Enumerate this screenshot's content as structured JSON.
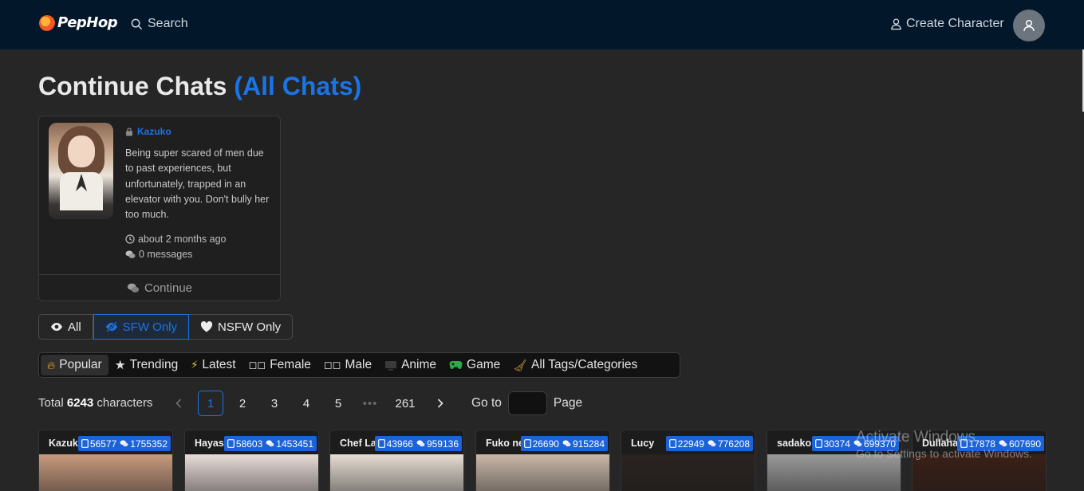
{
  "header": {
    "logo_text": "PepHop",
    "search_label": "Search",
    "create_label": "Create Character"
  },
  "title": {
    "main": "Continue Chats",
    "link": "(All Chats)"
  },
  "chat_card": {
    "name": "Kazuko",
    "description": "Being super scared of men due to past experiences, but unfortunately, trapped in an elevator with you. Don't bully her too much.",
    "last_active": "about 2 months ago",
    "messages": "0 messages",
    "continue_label": "Continue"
  },
  "filters": {
    "all": "All",
    "sfw": "SFW Only",
    "nsfw": "NSFW Only",
    "selected": "SFW Only"
  },
  "tags": [
    {
      "label": "Popular",
      "icon": "fire-icon",
      "active": true
    },
    {
      "label": "Trending",
      "icon": "star-icon"
    },
    {
      "label": "Latest",
      "icon": "bolt-icon"
    },
    {
      "label": "Female",
      "icon": "female-icon"
    },
    {
      "label": "Male",
      "icon": "male-icon"
    },
    {
      "label": "Anime",
      "icon": "tv-icon"
    },
    {
      "label": "Game",
      "icon": "gamepad-icon"
    },
    {
      "label": "All Tags/Categories",
      "icon": "broom-icon"
    }
  ],
  "pagination": {
    "total_prefix": "Total",
    "total_count": "6243",
    "total_suffix": "characters",
    "pages": [
      "1",
      "2",
      "3",
      "4",
      "5"
    ],
    "ellipsis": "•••",
    "last_page": "261",
    "current": "1",
    "goto_label": "Go to",
    "goto_value": "",
    "page_label": "Page"
  },
  "characters": [
    {
      "name": "Kazuko",
      "views": "56577",
      "chats": "1755352",
      "color": "#c79a7e"
    },
    {
      "name": "Hayase",
      "views": "58603",
      "chats": "1453451",
      "color": "#e8dcd8"
    },
    {
      "name": "Chef Lau",
      "views": "43966",
      "chats": "959136",
      "color": "#e6ddd2"
    },
    {
      "name": "Fuko ne",
      "views": "26690",
      "chats": "915284",
      "color": "#c9b7a8"
    },
    {
      "name": "Lucy",
      "views": "22949",
      "chats": "776208",
      "color": "#2a2320"
    },
    {
      "name": "sadako",
      "views": "30374",
      "chats": "699370",
      "color": "#9a9a9a"
    },
    {
      "name": "Dullahan",
      "views": "17878",
      "chats": "607690",
      "color": "#3a2018"
    }
  ],
  "watermark": {
    "line1": "Activate Windows",
    "line2": "Go to Settings to activate Windows."
  },
  "colors": {
    "accent": "#1b74e4",
    "topbar": "#03172b",
    "background": "#262626"
  }
}
